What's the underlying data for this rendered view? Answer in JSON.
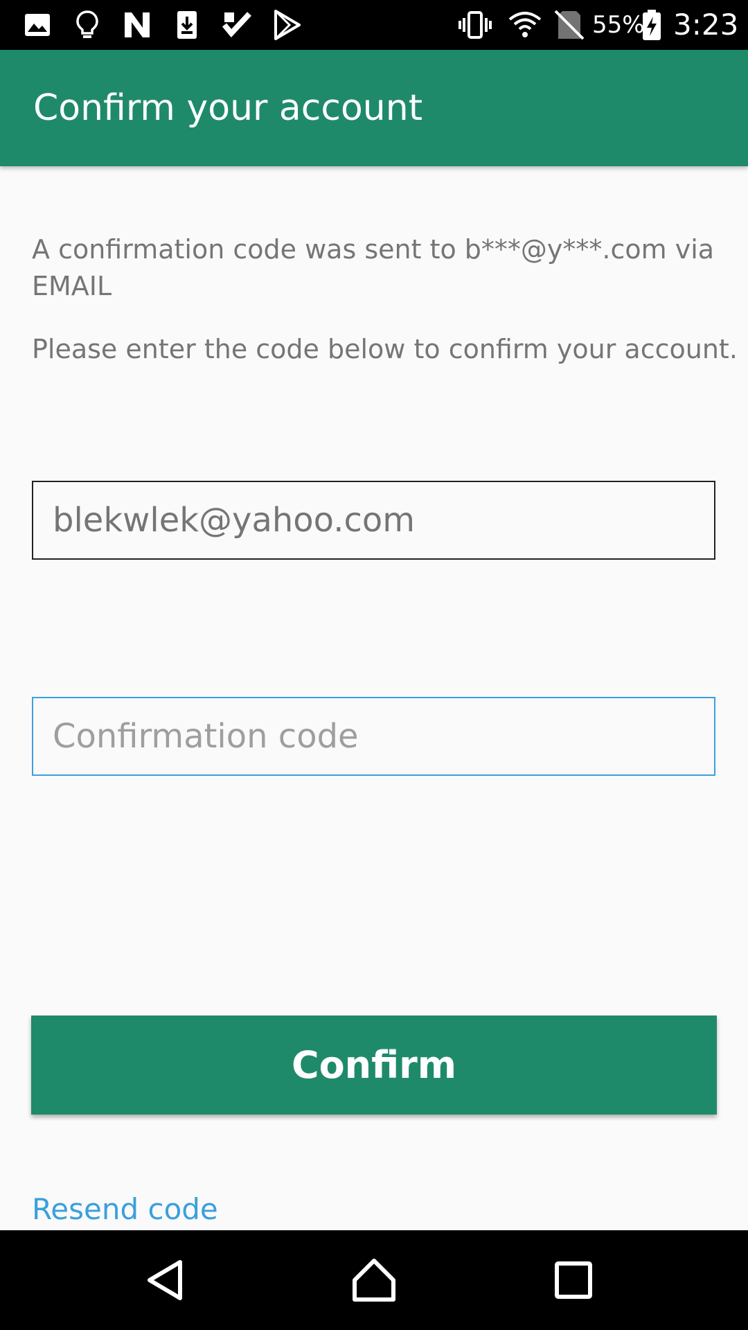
{
  "status_bar": {
    "battery_percent": "55%",
    "time": "3:23",
    "icons": [
      "gallery-icon",
      "lightbulb-icon",
      "n-app-icon",
      "download-icon",
      "checkmark-app-icon",
      "play-store-icon",
      "vibrate-icon",
      "wifi-icon",
      "no-sim-icon",
      "battery-charging-icon"
    ]
  },
  "app_bar": {
    "title": "Confirm your account",
    "color": "#1f8a6a"
  },
  "content": {
    "sent_message": "A confirmation code was sent to b***@y***.com via EMAIL",
    "instruction": "Please enter the code below to confirm your account.",
    "email_value": "blekwlek@yahoo.com",
    "code_placeholder": "Confirmation code",
    "confirm_label": "Confirm",
    "resend_label": "Resend code"
  },
  "colors": {
    "accent": "#1f8a6a",
    "link": "#3aa0dc"
  },
  "nav_bar": {
    "icons": [
      "back-icon",
      "home-icon",
      "recents-icon"
    ]
  }
}
